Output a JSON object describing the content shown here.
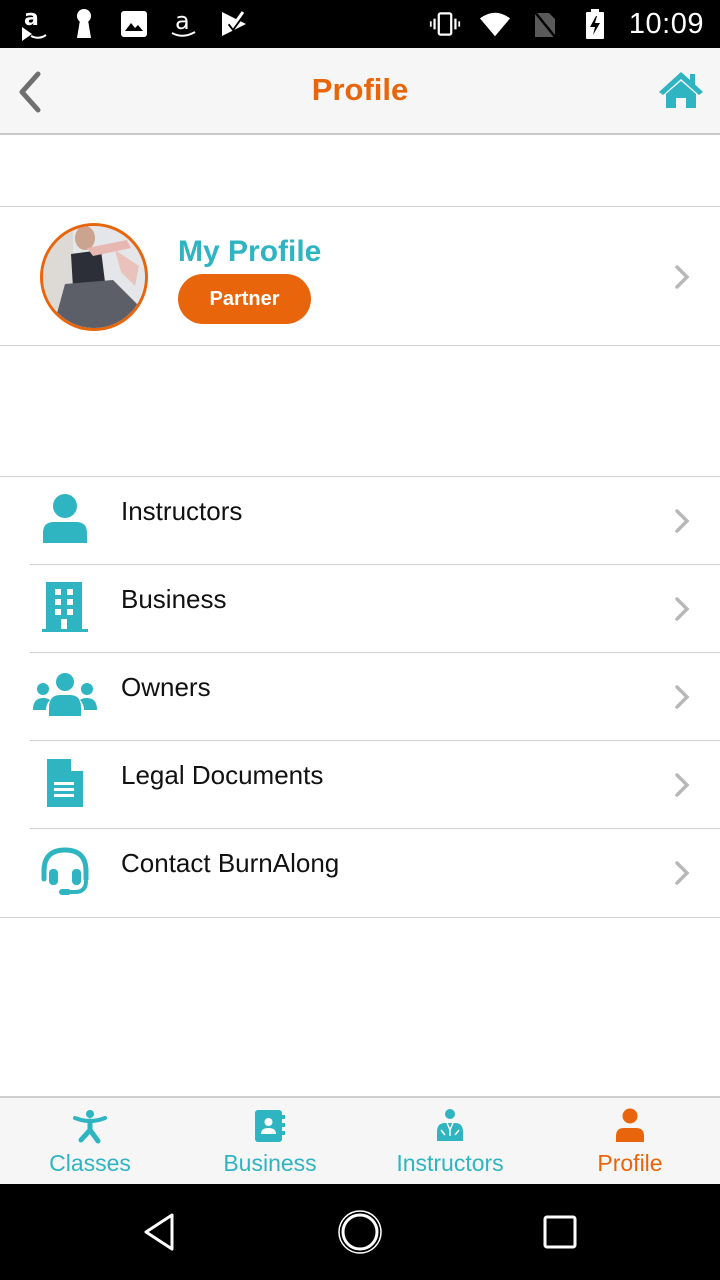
{
  "status_bar": {
    "left_icons": [
      "amazon-prime-video-icon",
      "keyhole-icon",
      "image-icon",
      "amazon-icon",
      "prime-check-icon"
    ],
    "right_icons": [
      "vibrate-icon",
      "wifi-icon",
      "no-sim-icon",
      "battery-charging-icon"
    ],
    "time": "10:09"
  },
  "app_bar": {
    "title": "Profile",
    "back_icon": "chevron-left-icon",
    "home_icon": "home-icon"
  },
  "profile_card": {
    "name": "My Profile",
    "badge": "Partner",
    "avatar": "profile-photo"
  },
  "menu": {
    "items": [
      {
        "label": "Instructors",
        "icon": "person-icon"
      },
      {
        "label": "Business",
        "icon": "building-icon"
      },
      {
        "label": "Owners",
        "icon": "group-icon"
      },
      {
        "label": "Legal Documents",
        "icon": "document-icon"
      },
      {
        "label": "Contact BurnAlong",
        "icon": "headset-icon"
      }
    ]
  },
  "bottom_nav": {
    "tabs": [
      {
        "label": "Classes",
        "icon": "exercise-figure-icon",
        "active": false
      },
      {
        "label": "Business",
        "icon": "contact-book-icon",
        "active": false
      },
      {
        "label": "Instructors",
        "icon": "instructor-icon",
        "active": false
      },
      {
        "label": "Profile",
        "icon": "person-icon",
        "active": true
      }
    ]
  },
  "colors": {
    "accent_orange": "#e8650c",
    "accent_teal": "#2fb4c2",
    "chevron_gray": "#b8b8b8"
  }
}
